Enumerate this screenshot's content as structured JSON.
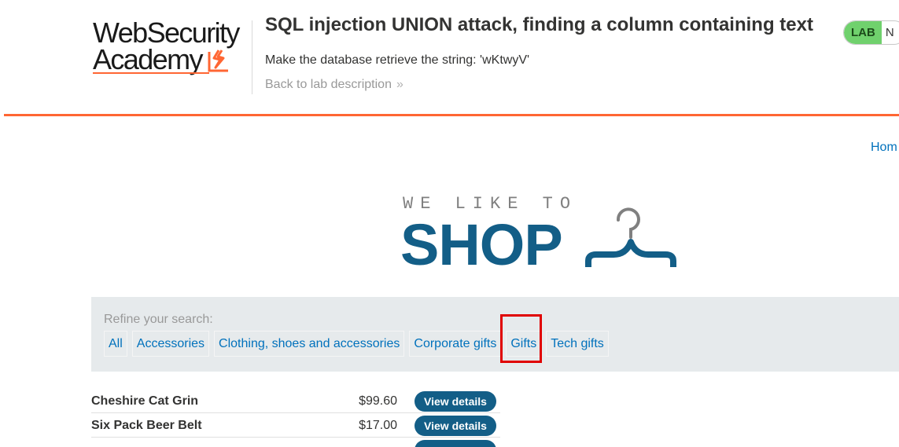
{
  "academy": {
    "logo_line1": "WebSecurity",
    "logo_line2": "Academy",
    "lab_title": "SQL injection UNION attack, finding a column containing text",
    "objective": "Make the database retrieve the string: 'wKtwyV'",
    "back_link": "Back to lab description",
    "back_chevron": "»",
    "lab_badge": "LAB",
    "lab_status": "N",
    "brand_color": "#ff6633"
  },
  "nav": {
    "home": "Hom"
  },
  "banner": {
    "top_text": "WE LIKE TO",
    "shop_text": "SHOP",
    "brand_color": "#135e87"
  },
  "filters": {
    "label": "Refine your search:",
    "items": [
      "All",
      "Accessories",
      "Clothing, shoes and accessories",
      "Corporate gifts",
      "Gifts",
      "Tech gifts"
    ],
    "highlighted": "Gifts",
    "highlight_color": "#e00000"
  },
  "products": [
    {
      "name": "Cheshire Cat Grin",
      "price": "$99.60",
      "action": "View details"
    },
    {
      "name": "Six Pack Beer Belt",
      "price": "$17.00",
      "action": "View details"
    },
    {
      "name": "",
      "price": "",
      "action": ""
    }
  ]
}
